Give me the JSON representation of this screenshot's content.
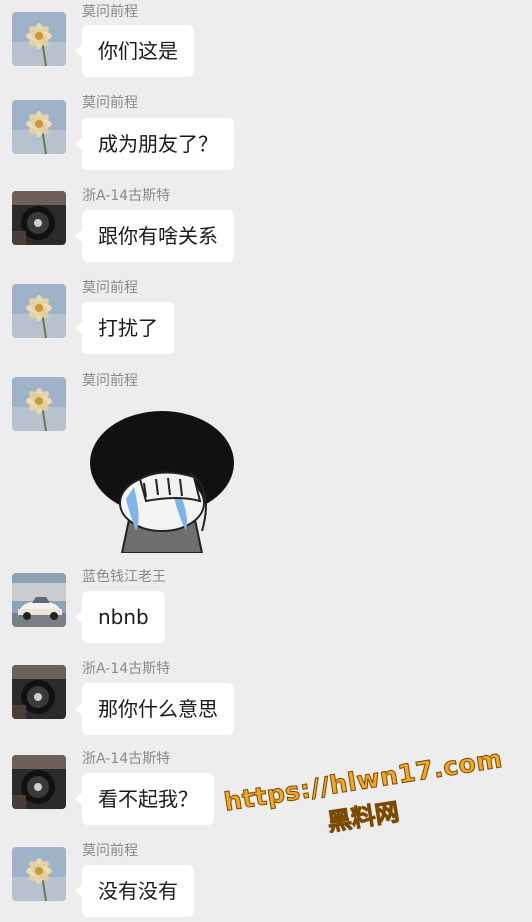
{
  "colors": {
    "background": "#ededed",
    "bubble": "#ffffff",
    "sender_name": "#8a8a8a",
    "watermark": "#f5a623"
  },
  "messages": [
    {
      "sender": "莫问前程",
      "avatar_icon": "flower-avatar-icon",
      "text": "你们这是"
    },
    {
      "sender": "莫问前程",
      "avatar_icon": "flower-avatar-icon",
      "text": "成为朋友了？"
    },
    {
      "sender": "浙A-14古斯特",
      "avatar_icon": "car-interior-avatar-icon",
      "text": "跟你有啥关系"
    },
    {
      "sender": "莫问前程",
      "avatar_icon": "flower-avatar-icon",
      "text": "打扰了"
    },
    {
      "sender": "莫问前程",
      "avatar_icon": "flower-avatar-icon",
      "sticker_icon": "crying-face-sticker-icon"
    },
    {
      "sender": "蓝色钱江老王",
      "avatar_icon": "white-car-avatar-icon",
      "text": "nbnb"
    },
    {
      "sender": "浙A-14古斯特",
      "avatar_icon": "car-interior-avatar-icon",
      "text": "那你什么意思"
    },
    {
      "sender": "浙A-14古斯特",
      "avatar_icon": "car-interior-avatar-icon",
      "text": "看不起我？"
    },
    {
      "sender": "莫问前程",
      "avatar_icon": "flower-avatar-icon",
      "text": "没有没有"
    }
  ],
  "watermark": {
    "url": "https://hlwn17.com",
    "text": "黑料网"
  }
}
